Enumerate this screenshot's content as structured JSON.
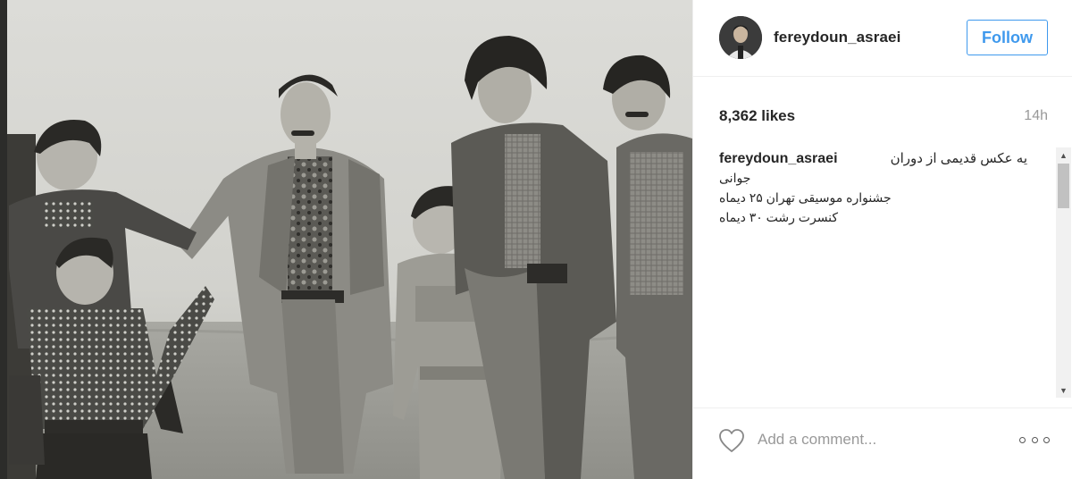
{
  "post": {
    "username": "fereydoun_asraei",
    "follow_label": "Follow",
    "likes": "8,362 likes",
    "time": "14h",
    "caption": {
      "user": "fereydoun_asraei",
      "line1": "یه عکس قدیمی از دوران",
      "line2": "جوانی",
      "line3": "جشنواره موسیقی تهران ۲۵ دیماه",
      "line4": "کنسرت رشت ۳۰ دیماه"
    },
    "comment_placeholder": "Add a comment..."
  },
  "icons": {
    "like": "heart-icon",
    "more": "more-options-icon",
    "scroll_up": "scroll-up-icon",
    "scroll_down": "scroll-down-icon"
  },
  "colors": {
    "accent": "#3f99ed",
    "text": "#262626",
    "muted": "#999999",
    "border": "#efefef"
  }
}
